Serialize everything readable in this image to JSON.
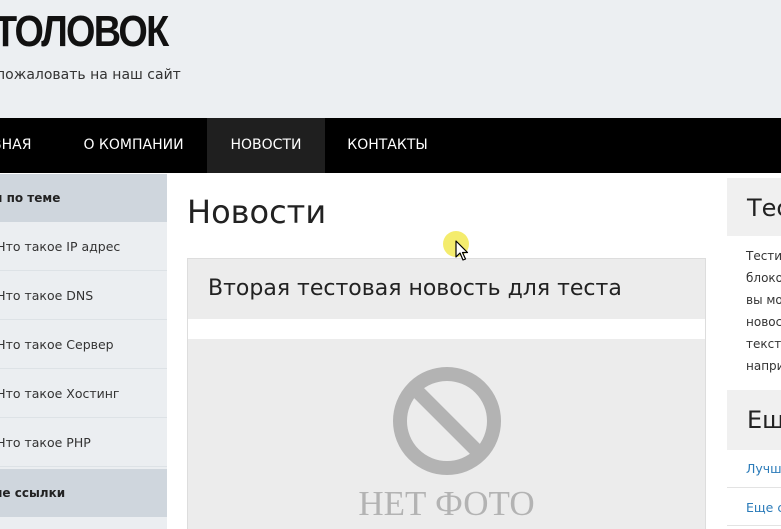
{
  "site": {
    "title": "ТОЛОВОК",
    "tagline": "пожаловать на наш сайт"
  },
  "nav": {
    "items": [
      {
        "label": "ВНАЯ"
      },
      {
        "label": "О КОМПАНИИ"
      },
      {
        "label": "НОВОСТИ",
        "active": true
      },
      {
        "label": "КОНТАКТЫ"
      }
    ]
  },
  "left_sidebar": {
    "heading1": "и по теме",
    "links": [
      {
        "label": "Что такое IP адрес"
      },
      {
        "label": "Что такое DNS"
      },
      {
        "label": "Что такое Сервер"
      },
      {
        "label": "Что такое Хостинг"
      },
      {
        "label": "Что такое PHP"
      }
    ],
    "heading2": "ие ссылки"
  },
  "main": {
    "page_title": "Новости",
    "news": {
      "title": "Вторая тестовая новость для теста",
      "image_placeholder_text": "НЕТ ФОТО"
    }
  },
  "right_sidebar": {
    "widget1_title": "Тес",
    "widget1_lines": [
      "Тести",
      "блоко",
      "вы мо",
      "новос",
      "текст,",
      "напри"
    ],
    "widget2_title": "Ещ",
    "widget2_links": [
      "Лучш",
      "Еще с"
    ]
  },
  "colors": {
    "header_bg": "#eceff2",
    "nav_bg": "#000000",
    "nav_active_bg": "#1f1f1f",
    "sidebar_heading_bg": "#cfd6dd",
    "link": "#2b7bb9"
  },
  "icons": {
    "no_photo": "no-photo-icon",
    "cursor": "mouse-cursor-icon"
  }
}
